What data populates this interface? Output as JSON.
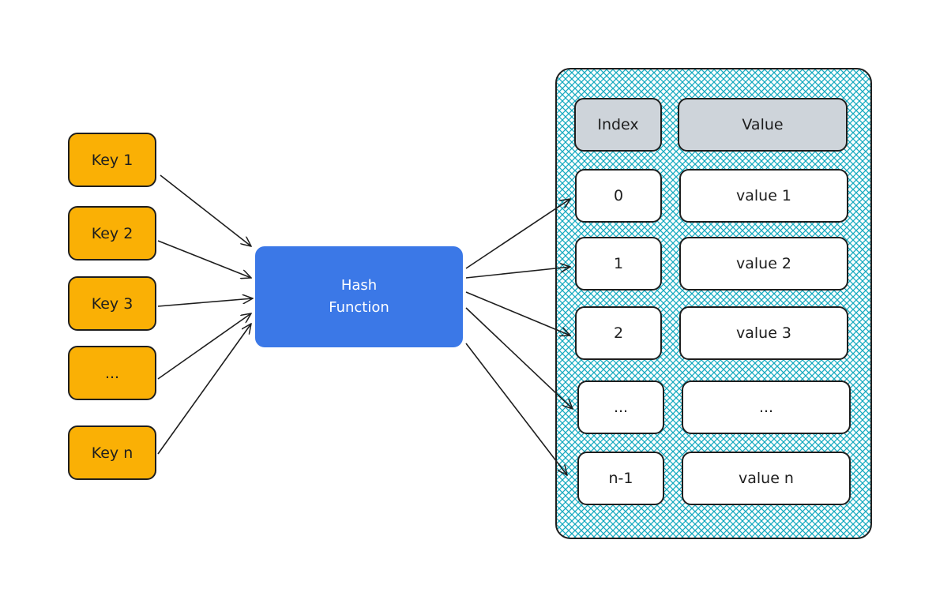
{
  "keys": [
    "Key 1",
    "Key 2",
    "Key 3",
    "...",
    "Key n"
  ],
  "hash_function": {
    "label": "Hash\nFunction"
  },
  "table": {
    "headers": {
      "index": "Index",
      "value": "Value"
    },
    "rows": [
      {
        "index": "0",
        "value": "value 1"
      },
      {
        "index": "1",
        "value": "value 2"
      },
      {
        "index": "2",
        "value": "value 3"
      },
      {
        "index": "...",
        "value": "..."
      },
      {
        "index": "n-1",
        "value": "value n"
      }
    ]
  },
  "colors": {
    "key_fill": "#fab005",
    "hash_fill": "#3b78e7",
    "table_hatch": "#15aabf",
    "header_fill": "#ced4da",
    "stroke": "#1e1e1e"
  }
}
